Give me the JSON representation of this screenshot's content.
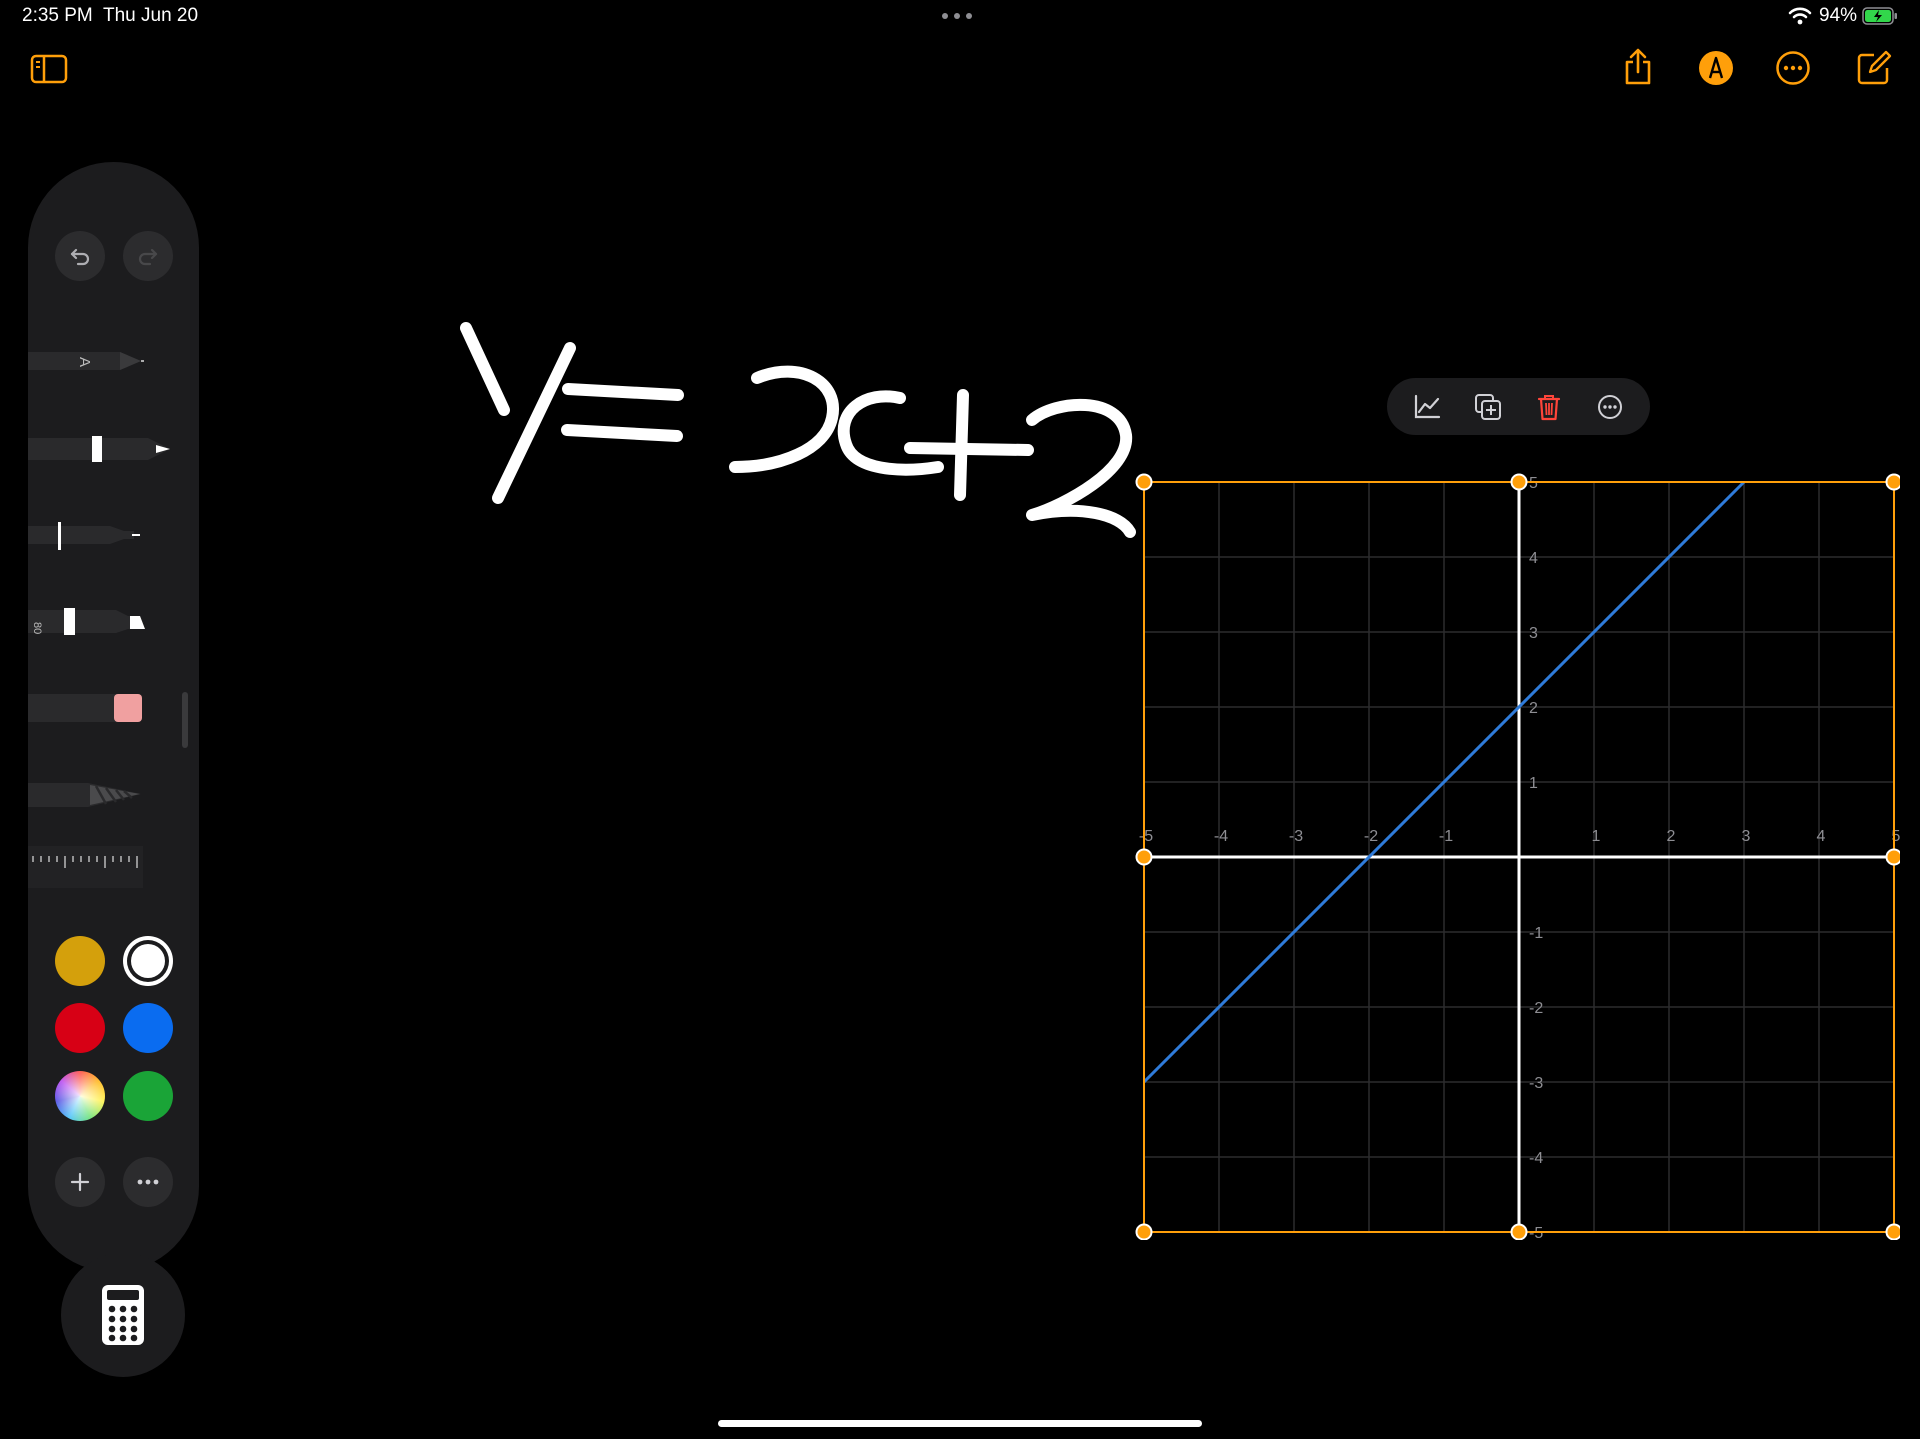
{
  "status_bar": {
    "time": "2:35 PM",
    "date": "Thu Jun 20",
    "battery": "94%",
    "wifi_icon": "wifi-icon",
    "battery_icon": "battery-charging-icon"
  },
  "toolbar": {
    "sidebar_icon": "sidebar-icon",
    "share_icon": "share-icon",
    "markup_icon": "markup-pen-icon",
    "more_icon": "ellipsis-circle-icon",
    "compose_icon": "compose-icon",
    "accent_color": "#ff9f0a"
  },
  "palette": {
    "undo_icon": "undo-icon",
    "redo_icon": "redo-icon",
    "tools": [
      "pen-A",
      "pen",
      "fine-liner",
      "marker",
      "eraser",
      "lasso",
      "ruler"
    ],
    "marker_label": "80",
    "pen_a_label": "A",
    "colors": [
      "#d4a00c",
      "#ffffff",
      "#d70015",
      "#0a6cf0",
      "color-wheel",
      "#1aa437"
    ],
    "selected_color": "#ffffff",
    "add_icon": "plus-icon",
    "more_icon": "ellipsis-icon"
  },
  "calculator_icon": "calculator-icon",
  "handwriting": {
    "equation": "Y= x+2"
  },
  "graph_menu": {
    "graph_icon": "graph-icon",
    "duplicate_icon": "duplicate-icon",
    "delete_icon": "trash-icon",
    "more_icon": "ellipsis-circle-icon",
    "delete_color": "#ff453a"
  },
  "chart_data": {
    "type": "line",
    "xlim": [
      -5,
      5
    ],
    "ylim": [
      -5,
      5
    ],
    "grid": true,
    "x_ticks": [
      "-5",
      "-4",
      "-3",
      "-2",
      "-1",
      "1",
      "2",
      "3",
      "4",
      "5"
    ],
    "y_ticks": [
      "5",
      "4",
      "3",
      "2",
      "1",
      "-1",
      "-2",
      "-3",
      "-4",
      "-5"
    ],
    "series": [
      {
        "x": [
          -5,
          3
        ],
        "y": [
          -3,
          5
        ],
        "color": "#2f7bd9"
      }
    ],
    "frame_color": "#ff9f0a"
  }
}
